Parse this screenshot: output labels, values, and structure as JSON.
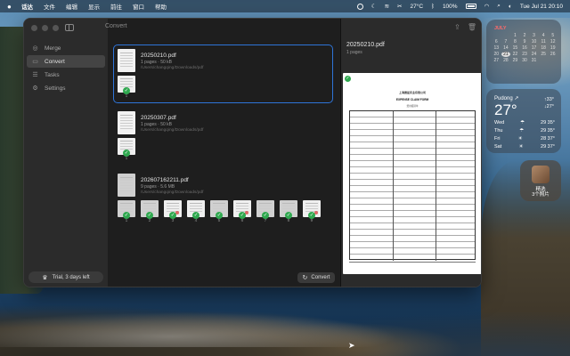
{
  "menubar": {
    "apple": "",
    "app_name": "话达",
    "menus": [
      "文件",
      "编辑",
      "显示",
      "前往",
      "窗口",
      "帮助"
    ],
    "status": {
      "weather": "27°C",
      "battery": "100%",
      "datetime": "Tue Jul 21  20:10"
    }
  },
  "window": {
    "title": "Convert",
    "sidebar": {
      "items": [
        {
          "icon": "merge-icon",
          "label": "Merge"
        },
        {
          "icon": "convert-icon",
          "label": "Convert"
        },
        {
          "icon": "tasks-icon",
          "label": "Tasks"
        },
        {
          "icon": "settings-icon",
          "label": "Settings"
        }
      ],
      "trial_label": "Trial, 3 days left"
    },
    "files": [
      {
        "name": "20250210.pdf",
        "meta": "1 pages · 50 kB",
        "path": "/Users/changqing/Downloads/pdf",
        "pages": [
          "1"
        ]
      },
      {
        "name": "20250307.pdf",
        "meta": "1 pages · 50 kB",
        "path": "/Users/changqing/Downloads/pdf",
        "pages": [
          "1"
        ]
      },
      {
        "name": "202607162211.pdf",
        "meta": "9 pages · 5.6 MB",
        "path": "/Users/changqing/Downloads/pdf",
        "pages": [
          "1",
          "2",
          "3",
          "4",
          "5",
          "6",
          "7",
          "8",
          "9"
        ]
      }
    ],
    "convert_label": "Convert",
    "preview": {
      "title": "20250210.pdf",
      "meta": "1 pages",
      "doc_header": "上海晨星实业有限公司",
      "doc_title": "EXPENSE CLAIM FORM",
      "doc_subtitle": "费用报销单"
    }
  },
  "widgets": {
    "calendar": {
      "month": "JULY",
      "days": [
        "",
        "",
        "1",
        "2",
        "3",
        "4",
        "5",
        "6",
        "7",
        "8",
        "9",
        "10",
        "11",
        "12",
        "13",
        "14",
        "15",
        "16",
        "17",
        "18",
        "19",
        "20",
        "21",
        "22",
        "23",
        "24",
        "25",
        "26",
        "27",
        "28",
        "29",
        "30",
        "31",
        "",
        ""
      ],
      "today": "21"
    },
    "weather": {
      "city": "Pudong ↗",
      "temp": "27°",
      "high": "↑33°",
      "low": "↓27°",
      "forecast": [
        {
          "day": "Wed",
          "icon": "rain-icon",
          "temp": "29 35°"
        },
        {
          "day": "Thu",
          "icon": "rain-icon",
          "temp": "29 35°"
        },
        {
          "day": "Fri",
          "icon": "sun-icon",
          "temp": "28 37°"
        },
        {
          "day": "Sat",
          "icon": "sun-icon",
          "temp": "29 37°"
        }
      ]
    },
    "photo": {
      "label": "精选\n3个照片"
    }
  }
}
